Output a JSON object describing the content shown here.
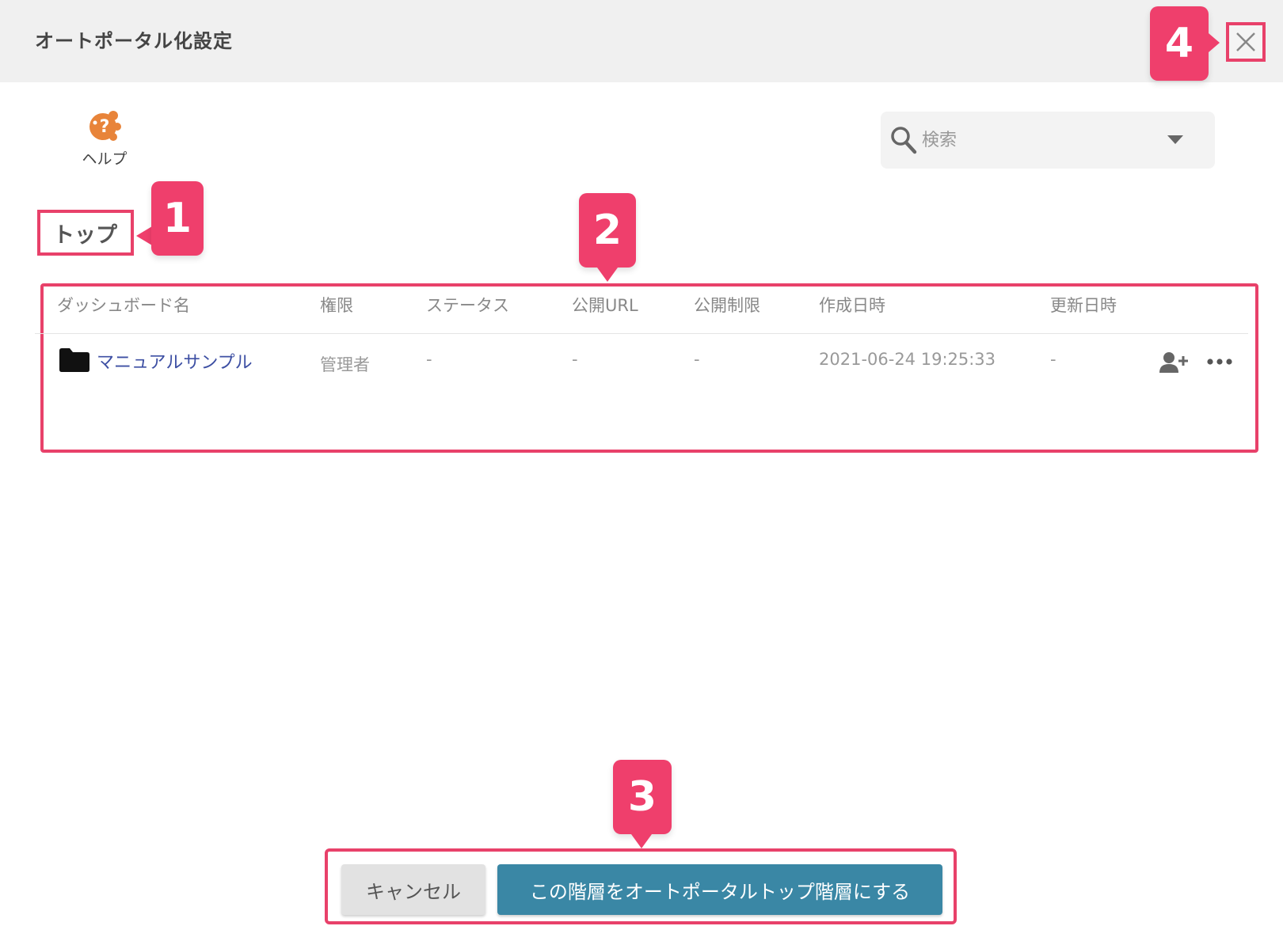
{
  "header": {
    "title": "オートポータル化設定"
  },
  "help": {
    "label": "ヘルプ"
  },
  "search": {
    "placeholder": "検索"
  },
  "breadcrumb": {
    "current": "トップ"
  },
  "table": {
    "columns": [
      "ダッシュボード名",
      "権限",
      "ステータス",
      "公開URL",
      "公開制限",
      "作成日時",
      "更新日時"
    ],
    "rows": [
      {
        "name": "マニュアルサンプル",
        "permission": "管理者",
        "status": "-",
        "public_url": "-",
        "public_restriction": "-",
        "created": "2021-06-24 19:25:33",
        "updated": "-"
      }
    ]
  },
  "footer": {
    "cancel_label": "キャンセル",
    "confirm_label": "この階層をオートポータルトップ階層にする"
  },
  "callouts": {
    "c1": "1",
    "c2": "2",
    "c3": "3",
    "c4": "4"
  },
  "colors": {
    "highlight": "#e8416a",
    "callout": "#ef3f6c",
    "primary_button": "#3a87a5",
    "link": "#3d4fa3",
    "help_icon": "#e8843a"
  }
}
